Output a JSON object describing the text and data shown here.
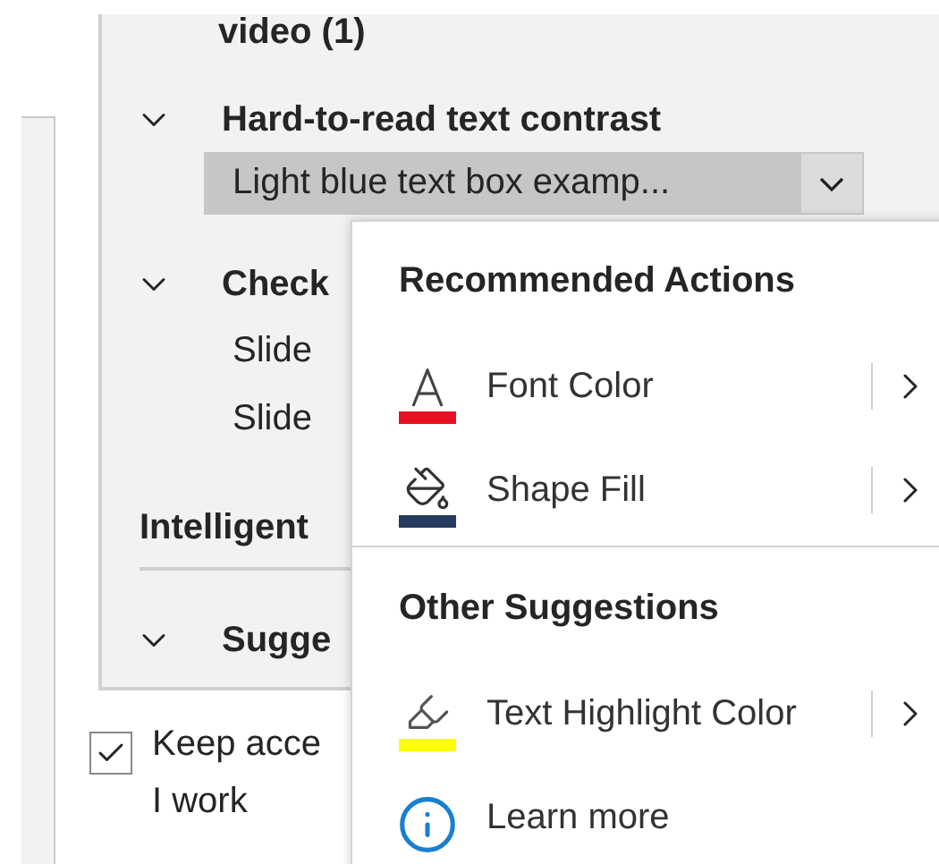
{
  "pane": {
    "top_heading": "video (1)",
    "groups": [
      {
        "title": "Hard-to-read text contrast",
        "expanded": true,
        "items": [
          {
            "label": "Light blue text box examp...",
            "selected": true
          }
        ]
      },
      {
        "title": "Check",
        "expanded": true,
        "items": [
          {
            "label": "Slide",
            "selected": false
          },
          {
            "label": "Slide",
            "selected": false
          }
        ]
      }
    ],
    "section_heading": "Intelligent",
    "section_groups": [
      {
        "title": "Sugge",
        "expanded": true
      }
    ]
  },
  "keep_option": {
    "lines": [
      "Keep acce",
      "I work"
    ],
    "checked": true
  },
  "context_menu": {
    "sections": [
      {
        "title": "Recommended Actions",
        "items": [
          {
            "kind": "font-color",
            "label": "Font Color",
            "color": "#e81123",
            "submenu": true
          },
          {
            "kind": "shape-fill",
            "label": "Shape Fill",
            "color": "#243a5e",
            "submenu": true
          }
        ]
      },
      {
        "title": "Other Suggestions",
        "items": [
          {
            "kind": "highlight",
            "label": "Text Highlight Color",
            "color": "#ffff00",
            "submenu": true
          },
          {
            "kind": "info",
            "label": "Learn more",
            "submenu": false
          }
        ]
      }
    ]
  }
}
